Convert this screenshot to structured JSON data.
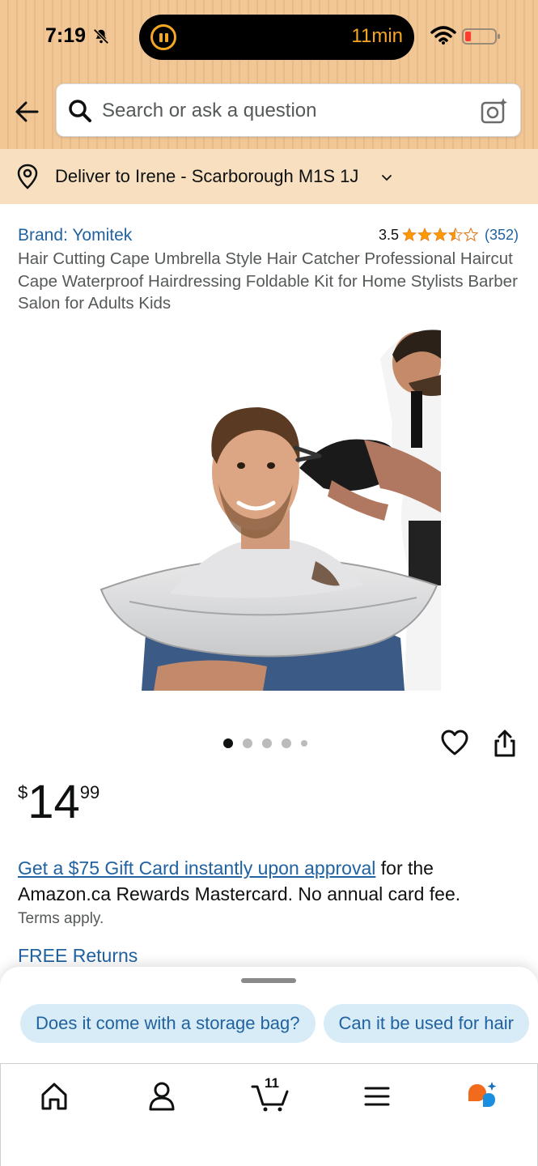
{
  "status_bar": {
    "time": "7:19",
    "live_activity": "11min",
    "icons": [
      "bell-slash-icon",
      "pause-icon",
      "wifi-icon",
      "battery-low-icon"
    ]
  },
  "header": {
    "search_placeholder": "Search or ask a question",
    "icons": [
      "back-arrow-icon",
      "search-icon",
      "camera-search-icon"
    ]
  },
  "delivery": {
    "text": "Deliver to Irene - Scarborough M1S 1J",
    "icon": "location-pin-icon"
  },
  "product": {
    "brand": "Brand: Yomitek",
    "rating": "3.5",
    "stars": 3.5,
    "rating_count": "(352)",
    "title": "Hair Cutting Cape Umbrella Style Hair Catcher Professional Haircut Cape Waterproof Hairdressing Foldable Kit for Home Stylists Barber Salon for Adults Kids",
    "image_alt": "Man wearing umbrella-style hair cutting cape while barber cuts his hair",
    "image_count": 5,
    "current_image": 1
  },
  "price": {
    "symbol": "$",
    "whole": "14",
    "fraction": "99"
  },
  "promo": {
    "link_text": "Get a $75 Gift Card instantly upon approval",
    "rest_text": " for the Amazon.ca Rewards Mastercard. No annual card fee.",
    "terms": "Terms apply."
  },
  "free_returns": "FREE Returns",
  "suggestions": [
    "Does it come with a storage bag?",
    "Can it be used for hair"
  ],
  "tabbar": {
    "cart_count": "11",
    "icons": [
      "home-icon",
      "account-icon",
      "cart-icon",
      "menu-icon",
      "rufus-assistant-icon"
    ]
  },
  "colors": {
    "link": "#2162a1",
    "star": "#ff9900",
    "header_bg": "#f2c796",
    "deliver_bg": "#f7dfc0",
    "chip_bg": "#d8ecf7",
    "island_accent": "#f5a623"
  }
}
